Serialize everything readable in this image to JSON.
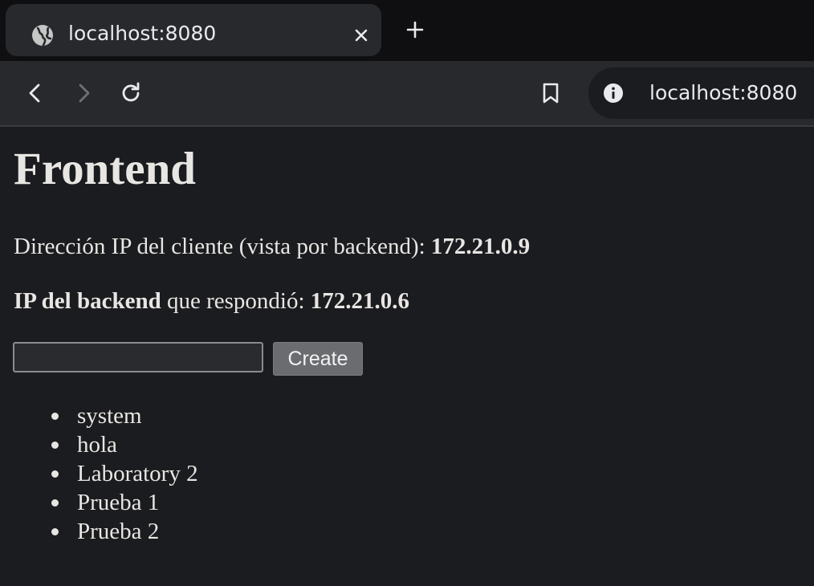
{
  "browser": {
    "tab": {
      "title": "localhost:8080",
      "favicon": "globe-icon",
      "close_icon": "close-icon"
    },
    "new_tab_icon": "plus-icon",
    "toolbar": {
      "back_icon": "back-arrow-icon",
      "forward_icon": "forward-arrow-icon",
      "reload_icon": "reload-icon",
      "bookmark_icon": "bookmark-icon",
      "site_info_icon": "info-icon",
      "url": "localhost:8080"
    }
  },
  "page": {
    "title": "Frontend",
    "client_ip": {
      "label": "Dirección IP del cliente (vista por backend): ",
      "value": "172.21.0.9"
    },
    "backend_ip": {
      "label_bold": "IP del backend",
      "label_rest": " que respondió: ",
      "value": "172.21.0.6"
    },
    "create_form": {
      "input_value": "",
      "button_label": "Create"
    },
    "items": [
      "system",
      "hola",
      "Laboratory 2",
      "Prueba 1",
      "Prueba 2"
    ]
  },
  "colors": {
    "page_background": "#1b1c1f",
    "toolbar_background": "#28292d",
    "tabstrip_background": "#0f0f11",
    "text": "#e8e6e3",
    "button_background": "#6b6c70"
  }
}
